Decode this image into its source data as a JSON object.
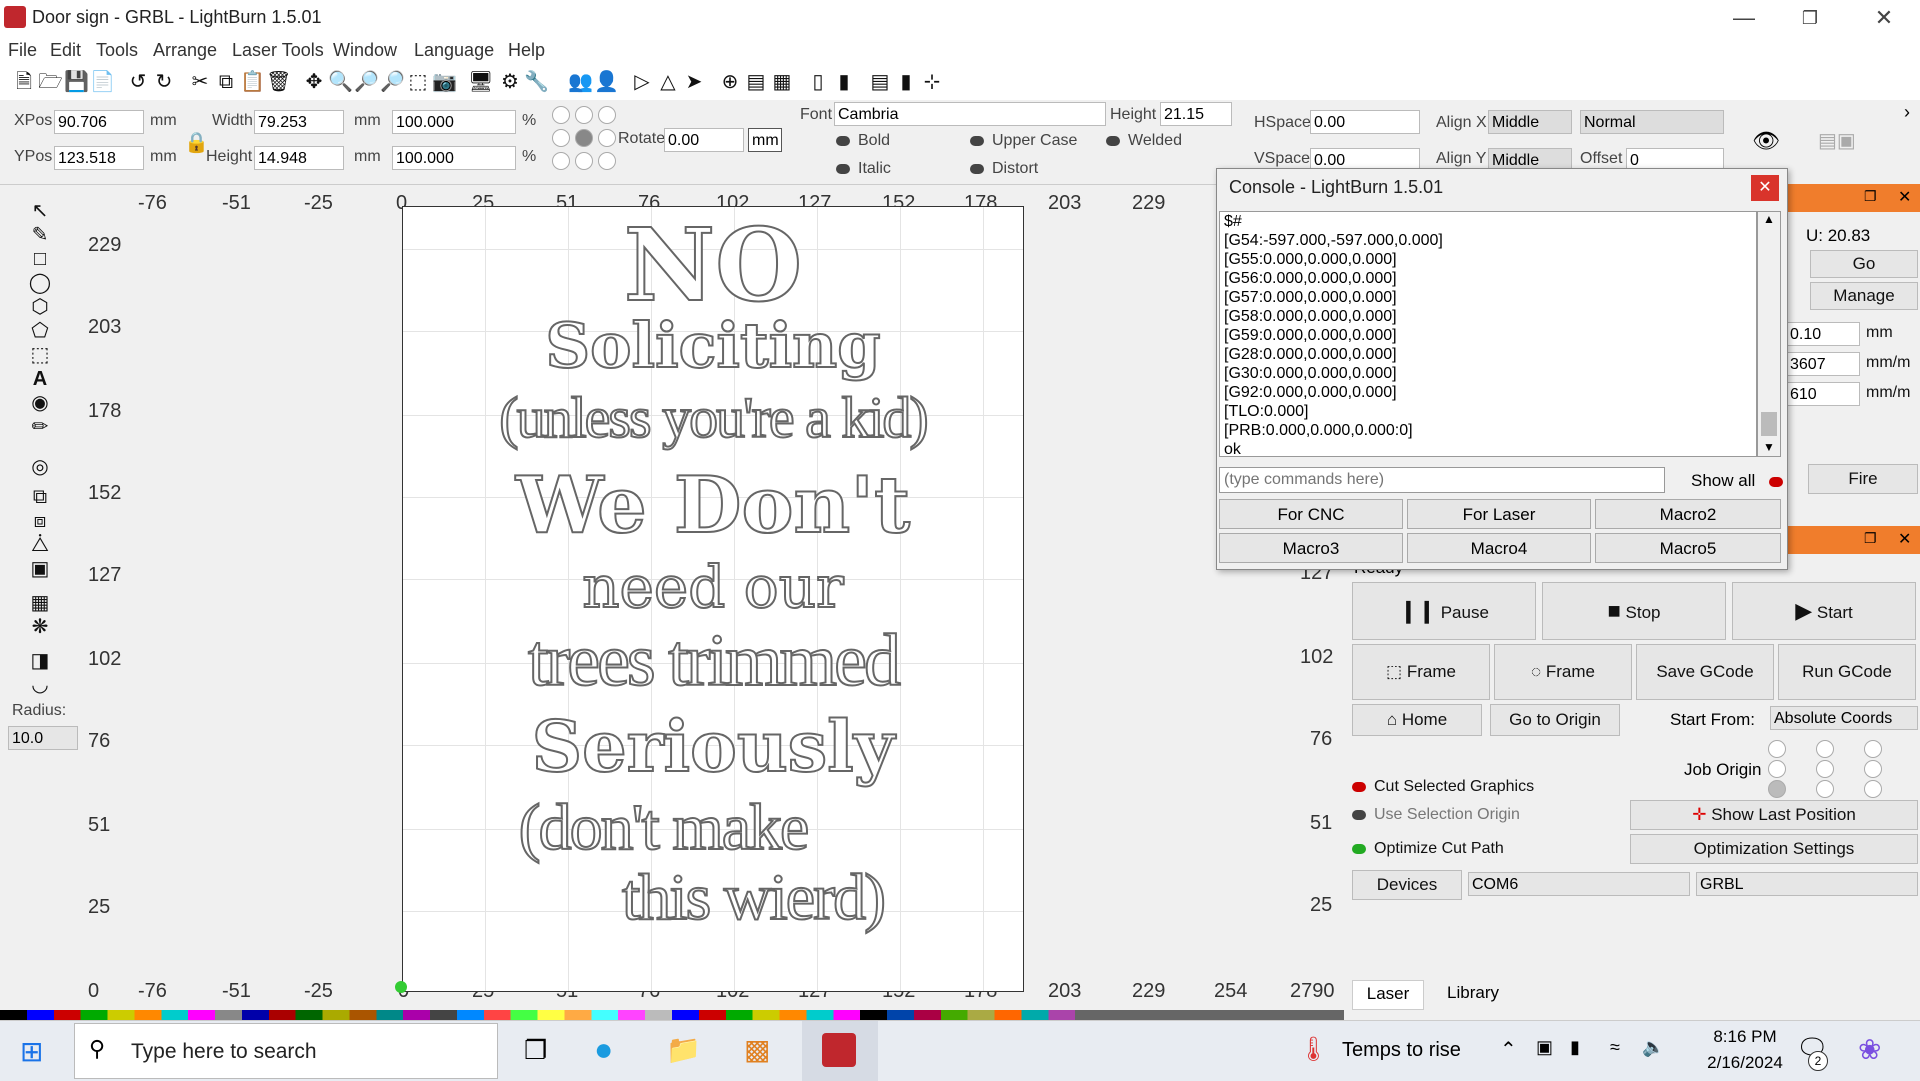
{
  "window": {
    "title": "Door sign - GRBL - LightBurn 1.5.01"
  },
  "menu": [
    "File",
    "Edit",
    "Tools",
    "Arrange",
    "Laser Tools",
    "Window",
    "Language",
    "Help"
  ],
  "props": {
    "xpos_label": "XPos",
    "xpos": "90.706",
    "ypos_label": "YPos",
    "ypos": "123.518",
    "unit": "mm",
    "width_label": "Width",
    "width": "79.253",
    "height_label": "Height",
    "height": "14.948",
    "scale_w": "100.000",
    "scale_h": "100.000",
    "pct": "%",
    "rotate_label": "Rotate",
    "rotate": "0.00",
    "mm_btn": "mm",
    "font_label": "Font",
    "font": "Cambria",
    "fheight_label": "Height",
    "fheight": "21.15",
    "bold": "Bold",
    "italic": "Italic",
    "upper": "Upper Case",
    "distort": "Distort",
    "welded": "Welded",
    "hspace_label": "HSpace",
    "hspace": "0.00",
    "vspace_label": "VSpace",
    "vspace": "0.00",
    "alignx_label": "Align X",
    "alignx": "Middle",
    "aligny_label": "Align Y",
    "aligny": "Middle",
    "normal": "Normal",
    "offset_label": "Offset",
    "offset": "0"
  },
  "lefttools": {
    "radius_label": "Radius:",
    "radius": "10.0"
  },
  "rulers": {
    "x": [
      "-76",
      "-51",
      "-25",
      "0",
      "25",
      "51",
      "76",
      "102",
      "127",
      "152",
      "178",
      "203",
      "229"
    ],
    "y": [
      "229",
      "203",
      "178",
      "152",
      "127",
      "102",
      "76",
      "51",
      "25"
    ],
    "xb": [
      "0",
      "-76",
      "-51",
      "-25",
      "0",
      "25",
      "51",
      "76",
      "102",
      "127",
      "152",
      "178",
      "203",
      "229",
      "254",
      "2790"
    ]
  },
  "sign": [
    "NO",
    "Soliciting",
    "(unless you're a kid)",
    "We Don't",
    "need our",
    "trees trimmed",
    "Seriously",
    "(don't make",
    "this wierd)"
  ],
  "console": {
    "title": "Console - LightBurn 1.5.01",
    "lines": [
      "$#",
      "[G54:-597.000,-597.000,0.000]",
      "[G55:0.000,0.000,0.000]",
      "[G56:0.000,0.000,0.000]",
      "[G57:0.000,0.000,0.000]",
      "[G58:0.000,0.000,0.000]",
      "[G59:0.000,0.000,0.000]",
      "[G28:0.000,0.000,0.000]",
      "[G30:0.000,0.000,0.000]",
      "[G92:0.000,0.000,0.000]",
      "[TLO:0.000]",
      "[PRB:0.000,0.000,0.000:0]",
      "ok"
    ],
    "placeholder": "(type commands here)",
    "show_all": "Show all",
    "macros": [
      "For CNC",
      "For Laser",
      "Macro2",
      "Macro3",
      "Macro4",
      "Macro5"
    ]
  },
  "move": {
    "u": "U: 20.83",
    "go": "Go",
    "manage": "Manage",
    "dist": "0.10",
    "dist_unit": "mm",
    "speed1": "3607",
    "speed2": "610",
    "speed_unit": "mm/m",
    "fire": "Fire"
  },
  "laser": {
    "status": "Ready",
    "pause": "Pause",
    "stop": "Stop",
    "start": "Start",
    "frame1": "Frame",
    "frame2": "Frame",
    "save_gcode": "Save GCode",
    "run_gcode": "Run GCode",
    "home": "Home",
    "go_origin": "Go to Origin",
    "start_from_label": "Start From:",
    "start_from": "Absolute Coords",
    "job_origin": "Job Origin",
    "cut_selected": "Cut Selected Graphics",
    "use_sel_origin": "Use Selection Origin",
    "show_last": "Show Last Position",
    "optimize": "Optimize Cut Path",
    "opt_settings": "Optimization Settings",
    "devices": "Devices",
    "port": "COM6",
    "device": "GRBL",
    "ruler_vals": [
      "127",
      "102",
      "76",
      "51",
      "25"
    ]
  },
  "tabs": [
    "Laser",
    "Library"
  ],
  "taskbar": {
    "search": "Type here to search",
    "weather": "Temps to rise",
    "time": "8:16 PM",
    "date": "2/16/2024",
    "notif": "2"
  },
  "colors": {
    "accent": "#f07d2c",
    "close": "#d9342b"
  }
}
